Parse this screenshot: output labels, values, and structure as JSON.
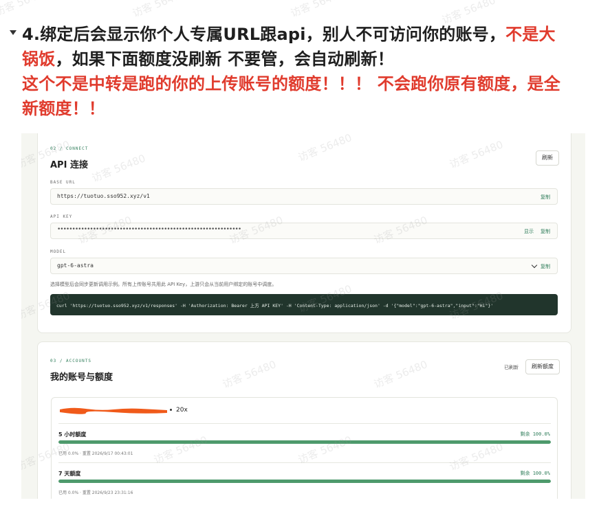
{
  "heading": {
    "line1_black": "4.绑定后会显示你个人专属URL跟api，别人不可访问你的账号，",
    "line1_red": "不是大",
    "line2_red": "锅饭",
    "line2_black": "，如果下面额度没刷新 不要管，会自动刷新！",
    "line3_red": "这个不是中转是跑的你的上传账号的额度！！！ 不会跑你原有额度，是全",
    "line4_red": "新额度！！"
  },
  "watermark": "访客 56480",
  "connect": {
    "label": "02 / CONNECT",
    "title": "API 连接",
    "refresh_button": "刷新",
    "base_url_label": "BASE URL",
    "base_url_value": "https://tuotuo.sso952.xyz/v1",
    "copy_label": "复制",
    "api_key_label": "API KEY",
    "api_key_masked": "••••••••••••••••••••••••••••••••••••••••••••••••••••••••••••••",
    "show_label": "显示",
    "model_label": "MODEL",
    "model_value": "gpt-6-astra",
    "hint": "选择模型后会同步更新调用示例。所有上传账号共用此 API Key，上游只会从当前用户绑定的账号中调度。",
    "curl": "curl 'https://tuotuo.sso952.xyz/v1/responses' -H 'Authorization: Bearer 上方 API KEY' -H 'Content-Type: application/json' -d '{\"model\":\"gpt-6-astra\",\"input\":\"Hi\"}'"
  },
  "accounts": {
    "label": "03 / ACCOUNTS",
    "title": "我的账号与额度",
    "status": "已刷新",
    "refresh_button": "刷新额度",
    "multiplier": "20x",
    "quotas": [
      {
        "title": "5 小时额度",
        "remaining": "剩余 100.0%",
        "used_fraction": 0.0,
        "meta": "已用 0.0% · 重置 2026/9/17 00:43:01"
      },
      {
        "title": "7 天额度",
        "remaining": "剩余 100.0%",
        "used_fraction": 0.0,
        "meta": "已用 0.0% · 重置 2026/9/23 23:31:16"
      }
    ]
  },
  "colors": {
    "accent_green": "#2f7d5a",
    "warning_red": "#e03b2d",
    "code_bg": "#21352c"
  }
}
